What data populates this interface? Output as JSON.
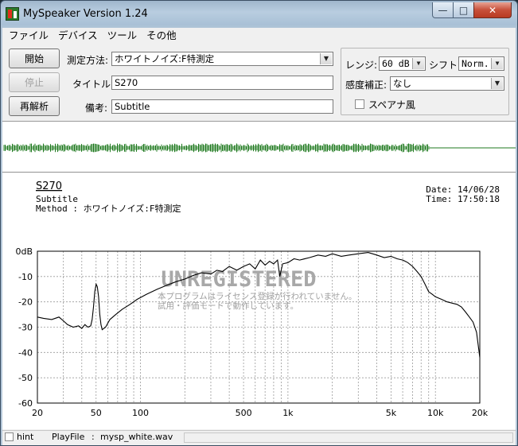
{
  "window": {
    "title": "MySpeaker Version 1.24",
    "minimize_glyph": "—",
    "maximize_glyph": "□",
    "close_glyph": "✕"
  },
  "menu": [
    "ファイル",
    "デバイス",
    "ツール",
    "その他"
  ],
  "controls": {
    "start_label": "開始",
    "stop_label": "停止",
    "reanalyze_label": "再解析",
    "method_label": "測定方法:",
    "method_value": "ホワイトノイズ:F特測定",
    "title_label": "タイトル:",
    "title_value": "S270",
    "note_label": "備考:",
    "note_value": "Subtitle",
    "range_label": "レンジ:",
    "range_value": "60 dB",
    "shift_label": "シフト:",
    "shift_value": "Norm.",
    "sens_label": "感度補正:",
    "sens_value": "なし",
    "spectrum_label": "スペアナ風",
    "spectrum_checked": false,
    "colors": {
      "waveform": "#1f7a1f",
      "curve": "#000000",
      "watermark": "#a8a8a8"
    }
  },
  "graph": {
    "title": "S270",
    "subtitle": "Subtitle",
    "method_line": "Method :  ホワイトノイズ:F特測定",
    "date_line": "Date: 14/06/28",
    "time_line": "Time: 17:50:18",
    "watermark_title": "UNREGISTERED",
    "watermark_line1": "本プログラムはライセンス登録が行われていません。",
    "watermark_line2": "試用・評価モードで動作しています。"
  },
  "chart_data": {
    "type": "line",
    "title": "S270",
    "xlabel": "",
    "ylabel": "",
    "xscale": "log",
    "xlim": [
      20,
      20000
    ],
    "ylim": [
      -60,
      0
    ],
    "grid": true,
    "x_ticks": [
      {
        "value": 20,
        "label": "20"
      },
      {
        "value": 50,
        "label": "50"
      },
      {
        "value": 100,
        "label": "100"
      },
      {
        "value": 500,
        "label": "500"
      },
      {
        "value": 1000,
        "label": "1k"
      },
      {
        "value": 5000,
        "label": "5k"
      },
      {
        "value": 10000,
        "label": "10k"
      },
      {
        "value": 20000,
        "label": "20k"
      }
    ],
    "y_ticks": [
      {
        "value": 0,
        "label": "0dB"
      },
      {
        "value": -10,
        "label": "-10"
      },
      {
        "value": -20,
        "label": "-20"
      },
      {
        "value": -30,
        "label": "-30"
      },
      {
        "value": -40,
        "label": "-40"
      },
      {
        "value": -50,
        "label": "-50"
      },
      {
        "value": -60,
        "label": "-60"
      }
    ],
    "series": [
      {
        "x": [
          20,
          22,
          25,
          28,
          30,
          32,
          35,
          38,
          40,
          42,
          44,
          46,
          47,
          48,
          49,
          50,
          51,
          52,
          53,
          54,
          55,
          58,
          62,
          68,
          75,
          85,
          95,
          110,
          130,
          150,
          175,
          200,
          230,
          260,
          300,
          330,
          360,
          400,
          450,
          500,
          550,
          600,
          650,
          700,
          750,
          800,
          850,
          880,
          920,
          1000,
          1100,
          1200,
          1400,
          1600,
          1800,
          2000,
          2300,
          2600,
          3000,
          3500,
          4000,
          4500,
          5000,
          5500,
          6000,
          6500,
          7000,
          7500,
          8000,
          8500,
          9000,
          9500,
          10000,
          11000,
          12000,
          13000,
          14000,
          15000,
          16000,
          17000,
          18000,
          19000,
          20000
        ],
        "y": [
          -26,
          -26.5,
          -27,
          -26,
          -27.5,
          -29,
          -30,
          -29.5,
          -30.5,
          -29,
          -30,
          -29.5,
          -27,
          -22,
          -16,
          -13,
          -14,
          -18,
          -25,
          -29,
          -31,
          -30,
          -27,
          -25,
          -23,
          -21,
          -19,
          -17,
          -15,
          -13.5,
          -12,
          -11,
          -9.5,
          -8.5,
          -9,
          -7.5,
          -8,
          -6,
          -7.5,
          -6,
          -5,
          -7,
          -3.5,
          -5.5,
          -4,
          -5,
          -3.5,
          -10,
          -5,
          -4.5,
          -3,
          -3.5,
          -2.5,
          -1.5,
          -2,
          -1,
          -2,
          -1.5,
          -1,
          -0.5,
          -1.5,
          -2.5,
          -2,
          -3,
          -3.5,
          -4.5,
          -6,
          -8,
          -10,
          -13,
          -16,
          -17,
          -18,
          -19,
          -20,
          -20.5,
          -21,
          -22,
          -24,
          -26,
          -28,
          -32,
          -42
        ]
      }
    ]
  },
  "status": {
    "hint_label": "hint",
    "playfile_label": "PlayFile",
    "playfile_sep": ":",
    "playfile_value": "mysp_white.wav"
  }
}
